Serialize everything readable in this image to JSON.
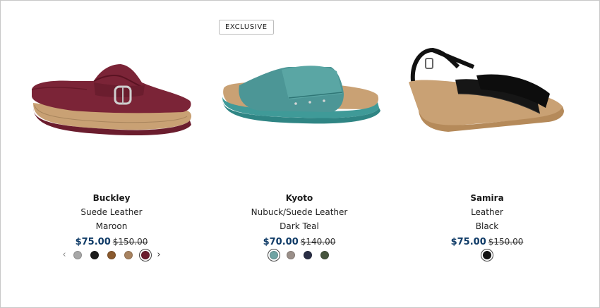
{
  "products": [
    {
      "name": "Buckley",
      "material": "Suede Leather",
      "color": "Maroon",
      "sale_price": "$75.00",
      "original_price": "$150.00",
      "badge": "",
      "swatches": [
        "#a7a7a7",
        "#1c1c1c",
        "#8a5a2e",
        "#a88360",
        "#6b1d2e"
      ],
      "selected_swatch": 4
    },
    {
      "name": "Kyoto",
      "material": "Nubuck/Suede Leather",
      "color": "Dark Teal",
      "sale_price": "$70.00",
      "original_price": "$140.00",
      "badge": "EXCLUSIVE",
      "swatches": [
        "#6fa3a3",
        "#9a8f89",
        "#2a2e45",
        "#46553d"
      ],
      "selected_swatch": 0
    },
    {
      "name": "Samira",
      "material": "Leather",
      "color": "Black",
      "sale_price": "$75.00",
      "original_price": "$150.00",
      "badge": "",
      "swatches": [
        "#111111"
      ],
      "selected_swatch": 0
    }
  ],
  "carousel": {
    "prev_arrow": "‹",
    "next_arrow": "›"
  }
}
